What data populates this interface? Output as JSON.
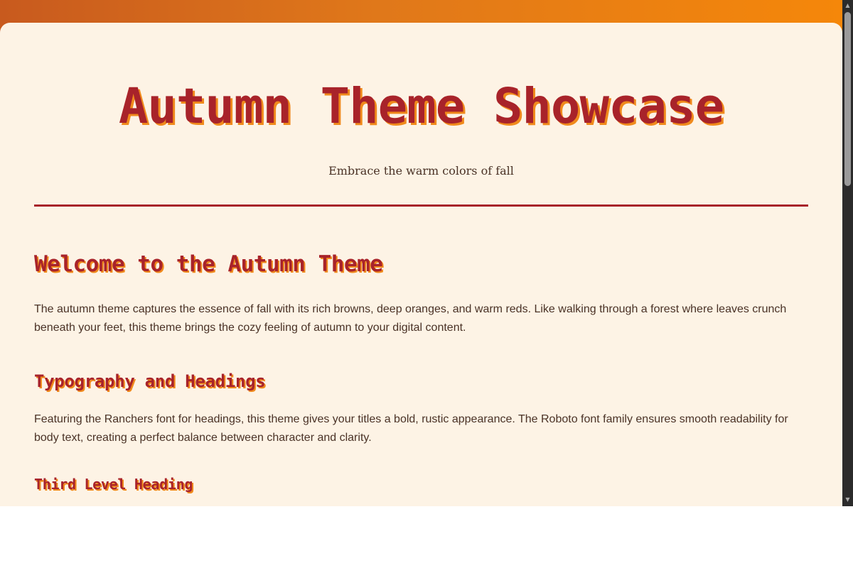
{
  "page": {
    "title": "Autumn Theme Showcase",
    "subtitle": "Embrace the warm colors of fall"
  },
  "sections": [
    {
      "heading": "Welcome to the Autumn Theme",
      "body": "The autumn theme captures the essence of fall with its rich browns, deep oranges, and warm reds. Like walking through a forest where leaves crunch beneath your feet, this theme brings the cozy feeling of autumn to your digital content."
    },
    {
      "heading": "Typography and Headings",
      "body": "Featuring the Ranchers font for headings, this theme gives your titles a bold, rustic appearance. The Roboto font family ensures smooth readability for body text, creating a perfect balance between character and clarity."
    },
    {
      "heading": "Third Level Heading"
    }
  ],
  "colors": {
    "background_gradient_start": "#c85a1e",
    "background_gradient_end": "#f5870a",
    "card": "#fdf3e5",
    "heading": "#a8232a",
    "heading_shadow": "#f08a1c",
    "body_text": "#4a3226",
    "divider": "#a8232a"
  },
  "scrollbar": {
    "up_icon": "scroll-up-arrow-icon",
    "down_icon": "scroll-down-arrow-icon",
    "up_glyph": "▲",
    "down_glyph": "▼"
  }
}
